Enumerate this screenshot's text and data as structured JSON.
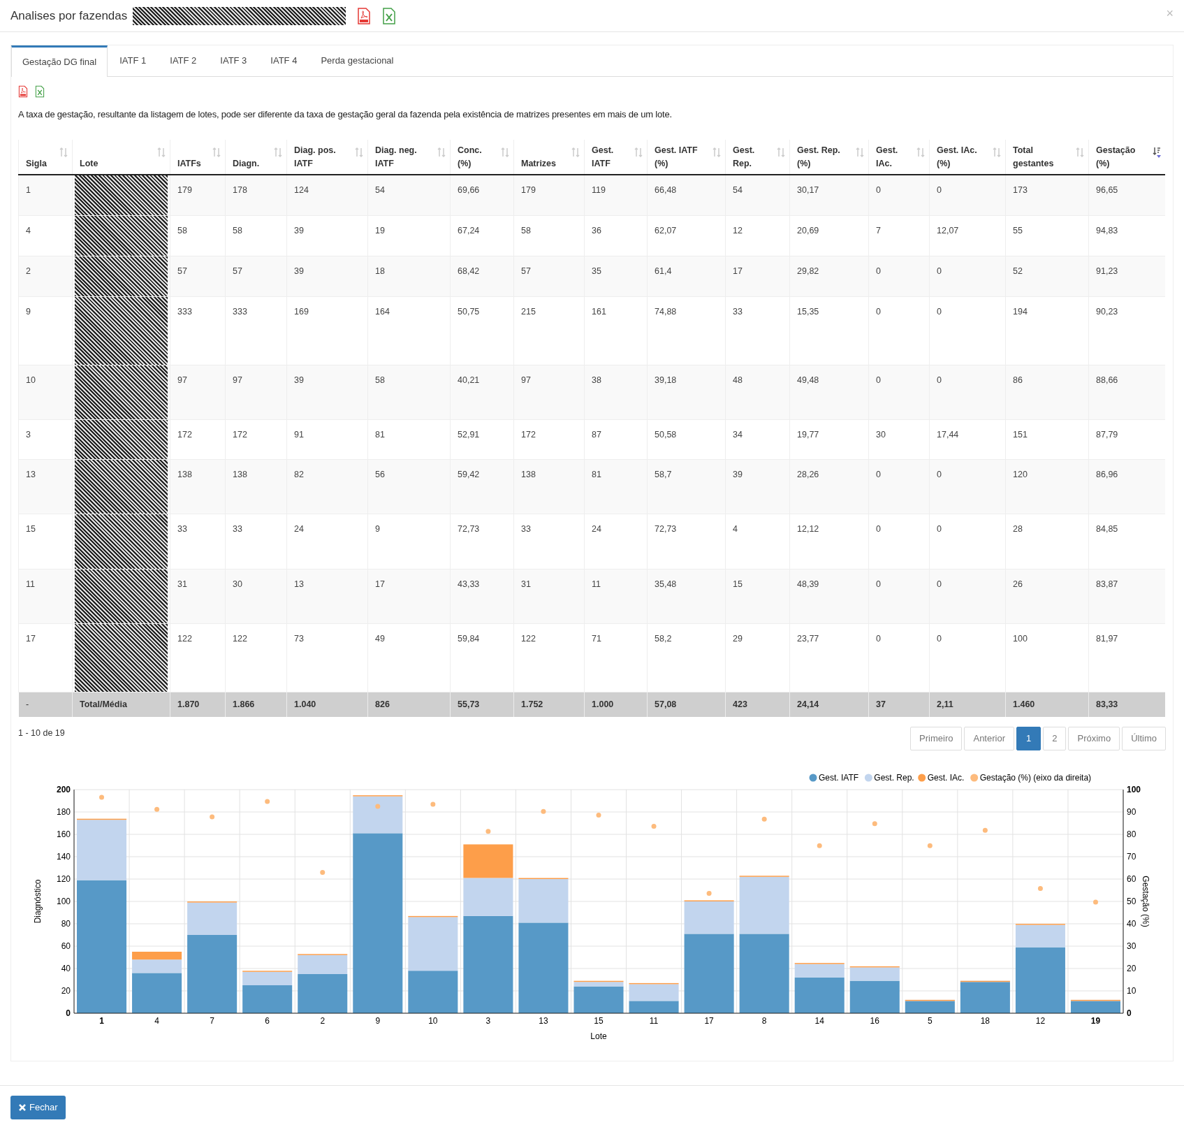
{
  "modal": {
    "title": "Analises por fazendas",
    "close": "×"
  },
  "tabs": [
    {
      "label": "Gestação DG final",
      "selected": true
    },
    {
      "label": "IATF 1",
      "selected": false
    },
    {
      "label": "IATF 2",
      "selected": false
    },
    {
      "label": "IATF 3",
      "selected": false
    },
    {
      "label": "IATF 4",
      "selected": false
    },
    {
      "label": "Perda gestacional",
      "selected": false
    }
  ],
  "note": "A taxa de gestação, resultante da listagem de lotes, pode ser diferente da taxa de gestação geral da fazenda pela existência de matrizes presentes em mais de um lote.",
  "table": {
    "columns": [
      {
        "label": "Sigla",
        "sorted": false
      },
      {
        "label": "Lote",
        "sorted": false
      },
      {
        "label": "IATFs",
        "sorted": false
      },
      {
        "label": "Diagn.",
        "sorted": false
      },
      {
        "label": "Diag. pos. IATF",
        "sorted": false
      },
      {
        "label": "Diag. neg. IATF",
        "sorted": false
      },
      {
        "label": "Conc. (%)",
        "sorted": false
      },
      {
        "label": "Matrizes",
        "sorted": false
      },
      {
        "label": "Gest. IATF",
        "sorted": false
      },
      {
        "label": "Gest. IATF (%)",
        "sorted": false
      },
      {
        "label": "Gest. Rep.",
        "sorted": false
      },
      {
        "label": "Gest. Rep. (%)",
        "sorted": false
      },
      {
        "label": "Gest. IAc.",
        "sorted": false
      },
      {
        "label": "Gest. IAc. (%)",
        "sorted": false
      },
      {
        "label": "Total gestantes",
        "sorted": false
      },
      {
        "label": "Gestação (%)",
        "sorted": true
      }
    ],
    "rows": [
      [
        "1",
        "",
        "179",
        "178",
        "124",
        "54",
        "69,66",
        "179",
        "119",
        "66,48",
        "54",
        "30,17",
        "0",
        "0",
        "173",
        "96,65"
      ],
      [
        "4",
        "",
        "58",
        "58",
        "39",
        "19",
        "67,24",
        "58",
        "36",
        "62,07",
        "12",
        "20,69",
        "7",
        "12,07",
        "55",
        "94,83"
      ],
      [
        "2",
        "",
        "57",
        "57",
        "39",
        "18",
        "68,42",
        "57",
        "35",
        "61,4",
        "17",
        "29,82",
        "0",
        "0",
        "52",
        "91,23"
      ],
      [
        "9",
        "",
        "333",
        "333",
        "169",
        "164",
        "50,75",
        "215",
        "161",
        "74,88",
        "33",
        "15,35",
        "0",
        "0",
        "194",
        "90,23"
      ],
      [
        "10",
        "",
        "97",
        "97",
        "39",
        "58",
        "40,21",
        "97",
        "38",
        "39,18",
        "48",
        "49,48",
        "0",
        "0",
        "86",
        "88,66"
      ],
      [
        "3",
        "",
        "172",
        "172",
        "91",
        "81",
        "52,91",
        "172",
        "87",
        "50,58",
        "34",
        "19,77",
        "30",
        "17,44",
        "151",
        "87,79"
      ],
      [
        "13",
        "",
        "138",
        "138",
        "82",
        "56",
        "59,42",
        "138",
        "81",
        "58,7",
        "39",
        "28,26",
        "0",
        "0",
        "120",
        "86,96"
      ],
      [
        "15",
        "",
        "33",
        "33",
        "24",
        "9",
        "72,73",
        "33",
        "24",
        "72,73",
        "4",
        "12,12",
        "0",
        "0",
        "28",
        "84,85"
      ],
      [
        "11",
        "",
        "31",
        "30",
        "13",
        "17",
        "43,33",
        "31",
        "11",
        "35,48",
        "15",
        "48,39",
        "0",
        "0",
        "26",
        "83,87"
      ],
      [
        "17",
        "",
        "122",
        "122",
        "73",
        "49",
        "59,84",
        "122",
        "71",
        "58,2",
        "29",
        "23,77",
        "0",
        "0",
        "100",
        "81,97"
      ]
    ],
    "total": [
      "-",
      "Total/Média",
      "1.870",
      "1.866",
      "1.040",
      "826",
      "55,73",
      "1.752",
      "1.000",
      "57,08",
      "423",
      "24,14",
      "37",
      "2,11",
      "1.460",
      "83,33"
    ]
  },
  "range": "1 - 10 de 19",
  "pagination": [
    {
      "label": "Primeiro",
      "selected": false
    },
    {
      "label": "Anterior",
      "selected": false
    },
    {
      "label": "1",
      "selected": true
    },
    {
      "label": "2",
      "selected": false
    },
    {
      "label": "Próximo",
      "selected": false
    },
    {
      "label": "Último",
      "selected": false
    }
  ],
  "chart": {
    "chart_data": {
      "type": "bar",
      "stacked": true,
      "grid": true,
      "legend": true,
      "xlabel": "Lote",
      "ylabel": "Diagnóstico",
      "y2label": "Gestação (%)",
      "categories": [
        "1",
        "4",
        "7",
        "6",
        "2",
        "9",
        "10",
        "3",
        "13",
        "15",
        "11",
        "17",
        "8",
        "14",
        "16",
        "5",
        "18",
        "12",
        "19"
      ],
      "ylim": [
        0,
        200
      ],
      "y2lim": [
        0,
        100
      ],
      "yticks": [
        0,
        20,
        40,
        60,
        80,
        100,
        120,
        140,
        160,
        180,
        200
      ],
      "y2ticks": [
        0,
        10,
        20,
        30,
        40,
        50,
        60,
        70,
        80,
        90,
        100
      ],
      "series": [
        {
          "name": "Gest. IATF",
          "color": "#5799c7",
          "values": [
            119,
            36,
            70,
            25,
            35,
            161,
            38,
            87,
            81,
            24,
            11,
            71,
            71,
            32,
            29,
            11,
            28,
            59,
            11
          ]
        },
        {
          "name": "Gest. Rep.",
          "color": "#c2d5ee",
          "values": [
            54,
            12,
            29,
            12,
            17,
            33,
            48,
            34,
            39,
            4,
            15,
            29,
            51,
            12,
            12,
            0,
            0,
            20,
            0
          ]
        },
        {
          "name": "Gest. IAc.",
          "color": "#fd9e4a",
          "values": [
            0,
            7,
            0,
            0,
            0,
            0,
            0,
            30,
            0,
            0,
            0,
            0,
            0,
            0,
            0,
            0,
            0,
            0,
            0
          ]
        },
        {
          "name": "Gestação (%) (eixo da direita)",
          "type": "scatter",
          "axis": "y2",
          "color": "#fdbb7d",
          "values": [
            96.6,
            91.2,
            87.8,
            94.7,
            63,
            92.5,
            93.4,
            81.3,
            90.2,
            88.6,
            83.6,
            53.6,
            86.8,
            74.9,
            84.8,
            74.9,
            81.8,
            55.8,
            49.7
          ]
        }
      ]
    }
  },
  "footer": {
    "button": "Fechar"
  }
}
